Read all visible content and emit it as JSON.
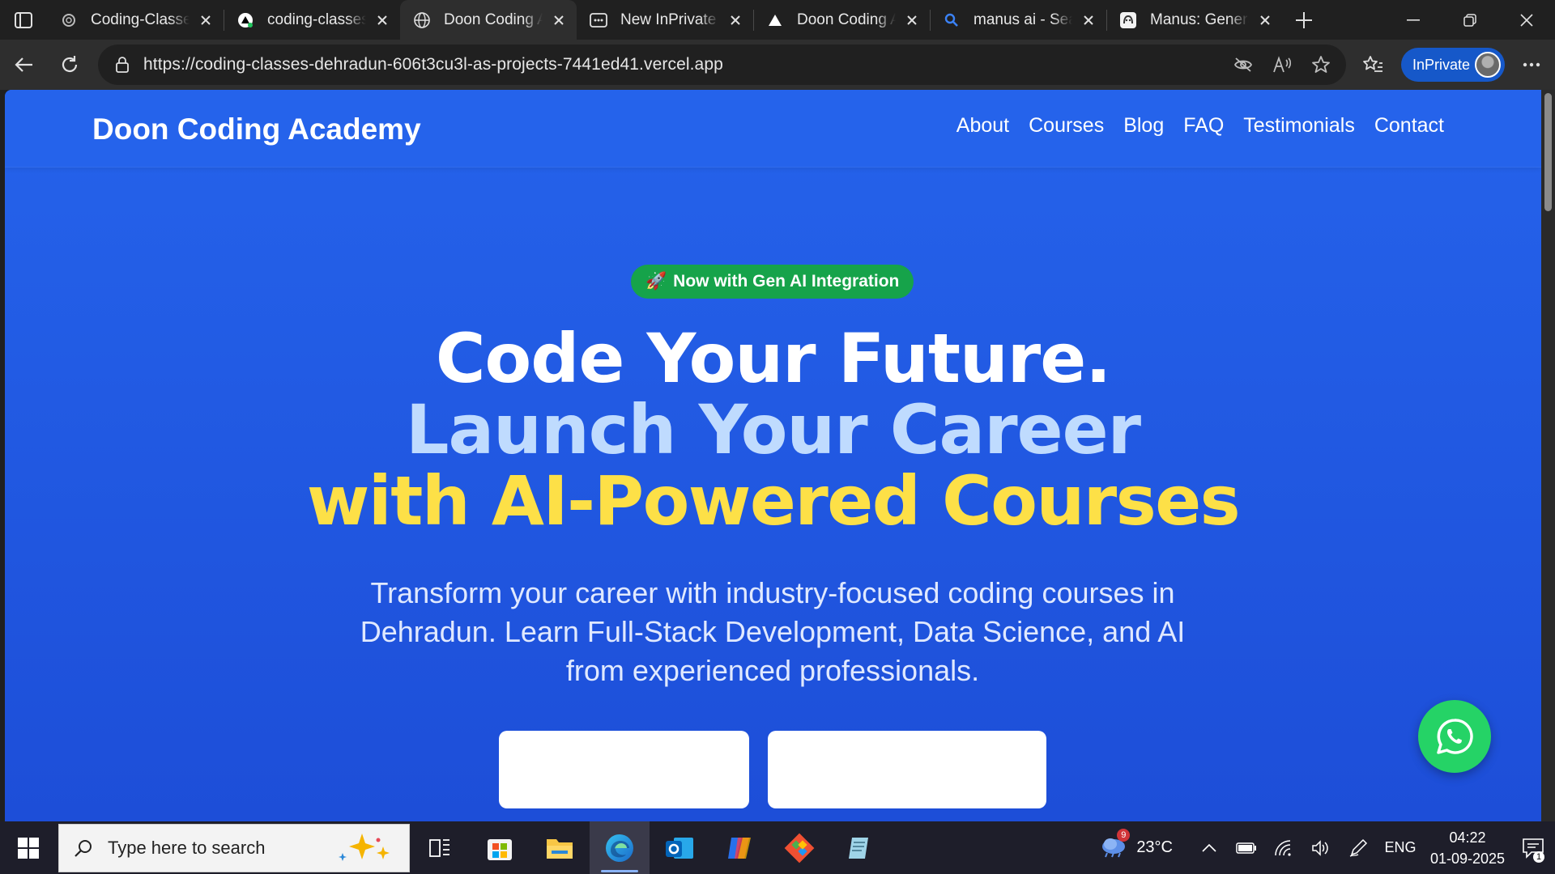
{
  "browser": {
    "tabs": [
      {
        "title": "Coding-Classes",
        "favicon": "openai-icon",
        "active": false
      },
      {
        "title": "coding-classes-",
        "favicon": "vercel-icon",
        "active": false
      },
      {
        "title": "Doon Coding A",
        "favicon": "globe-icon",
        "active": true
      },
      {
        "title": "New InPrivate t",
        "favicon": "inprivate-tab-icon",
        "active": false
      },
      {
        "title": "Doon Coding A",
        "favicon": "vercel-icon",
        "active": false
      },
      {
        "title": "manus ai - Sear",
        "favicon": "search-icon",
        "active": false
      },
      {
        "title": "Manus: General",
        "favicon": "manus-icon",
        "active": false
      }
    ],
    "url": "https://coding-classes-dehradun-606t3cu3l-as-projects-7441ed41.vercel.app",
    "inprivate_label": "InPrivate"
  },
  "site": {
    "logo": "Doon Coding Academy",
    "nav": [
      "About",
      "Courses",
      "Blog",
      "FAQ",
      "Testimonials",
      "Contact"
    ],
    "badge_icon": "🚀",
    "badge_text": "Now with Gen AI Integration",
    "hero_line1": "Code Your Future.",
    "hero_line2": "Launch Your Career",
    "hero_line3": "with AI-Powered Courses",
    "hero_sub": "Transform your career with industry-focused coding courses in Dehradun. Learn Full-Stack Development, Data Science, and AI from experienced professionals.",
    "colors": {
      "bg": "#2563eb",
      "line2": "#bfdbfe",
      "line3": "#fde047",
      "badge": "#16a34a",
      "whatsapp": "#25d366"
    }
  },
  "taskbar": {
    "search_placeholder": "Type here to search",
    "weather_temp": "23°C",
    "weather_badge": "9",
    "language": "ENG",
    "time": "04:22",
    "date": "01-09-2025",
    "notifications": "1",
    "apps": [
      "task-view-icon",
      "microsoft-store-icon",
      "file-explorer-icon",
      "edge-icon",
      "outlook-icon",
      "copilot-icon",
      "git-icon",
      "notepad-icon"
    ]
  }
}
